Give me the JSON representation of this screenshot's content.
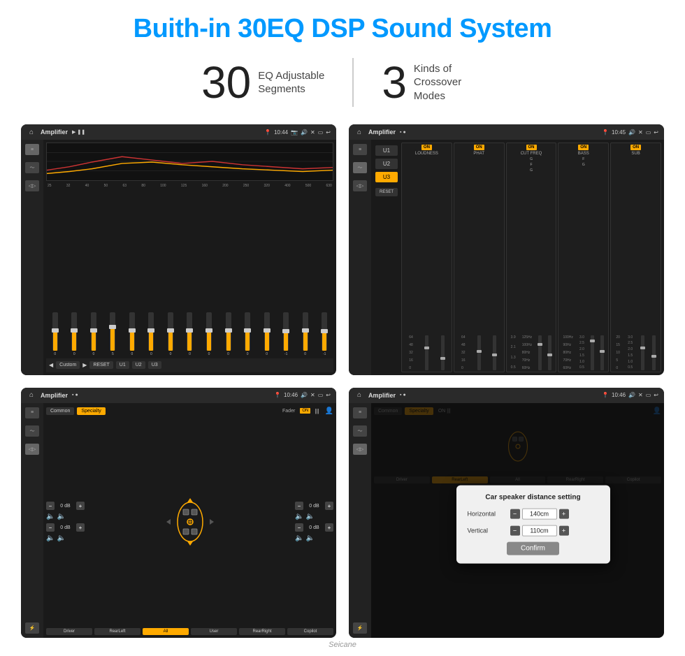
{
  "header": {
    "title": "Buith-in 30EQ DSP Sound System"
  },
  "stats": [
    {
      "number": "30",
      "label": "EQ Adjustable\nSegments"
    },
    {
      "number": "3",
      "label": "Kinds of\nCrossover Modes"
    }
  ],
  "screens": {
    "screen1": {
      "topbar": {
        "title": "Amplifier",
        "time": "10:44"
      },
      "frequencies": [
        "25",
        "32",
        "40",
        "50",
        "63",
        "80",
        "100",
        "125",
        "160",
        "200",
        "250",
        "320",
        "400",
        "500",
        "630"
      ],
      "values": [
        "0",
        "0",
        "0",
        "0",
        "5",
        "0",
        "0",
        "0",
        "0",
        "0",
        "0",
        "0",
        "0",
        "-1",
        "0",
        "-1"
      ],
      "bottomBtns": [
        "Custom",
        "RESET",
        "U1",
        "U2",
        "U3"
      ]
    },
    "screen2": {
      "topbar": {
        "title": "Amplifier",
        "time": "10:45"
      },
      "uBtns": [
        "U1",
        "U2",
        "U3"
      ],
      "channels": [
        {
          "name": "LOUDNESS",
          "on": true
        },
        {
          "name": "PHAT",
          "on": true
        },
        {
          "name": "CUT FREQ",
          "on": true
        },
        {
          "name": "BASS",
          "on": true
        },
        {
          "name": "SUB",
          "on": true
        }
      ],
      "resetBtn": "RESET"
    },
    "screen3": {
      "topbar": {
        "title": "Amplifier",
        "time": "10:46"
      },
      "topBtns": [
        "Common",
        "Specialty"
      ],
      "faderLabel": "Fader",
      "faderOn": "ON",
      "volumes": [
        {
          "label": "0 dB"
        },
        {
          "label": "0 dB"
        },
        {
          "label": "0 dB"
        },
        {
          "label": "0 dB"
        }
      ],
      "bottomBtns": [
        "Driver",
        "RearLeft",
        "All",
        "User",
        "RearRight",
        "Copilot"
      ]
    },
    "screen4": {
      "topbar": {
        "title": "Amplifier",
        "time": "10:46"
      },
      "topBtns": [
        "Common",
        "Specialty"
      ],
      "dialog": {
        "title": "Car speaker distance setting",
        "horizontal": {
          "label": "Horizontal",
          "value": "140cm"
        },
        "vertical": {
          "label": "Vertical",
          "value": "110cm"
        },
        "confirmBtn": "Confirm"
      },
      "bottomBtns": [
        "Driver",
        "RearLeft",
        "All",
        "User",
        "RearRight",
        "Copilot"
      ]
    }
  },
  "watermark": "Seicane"
}
